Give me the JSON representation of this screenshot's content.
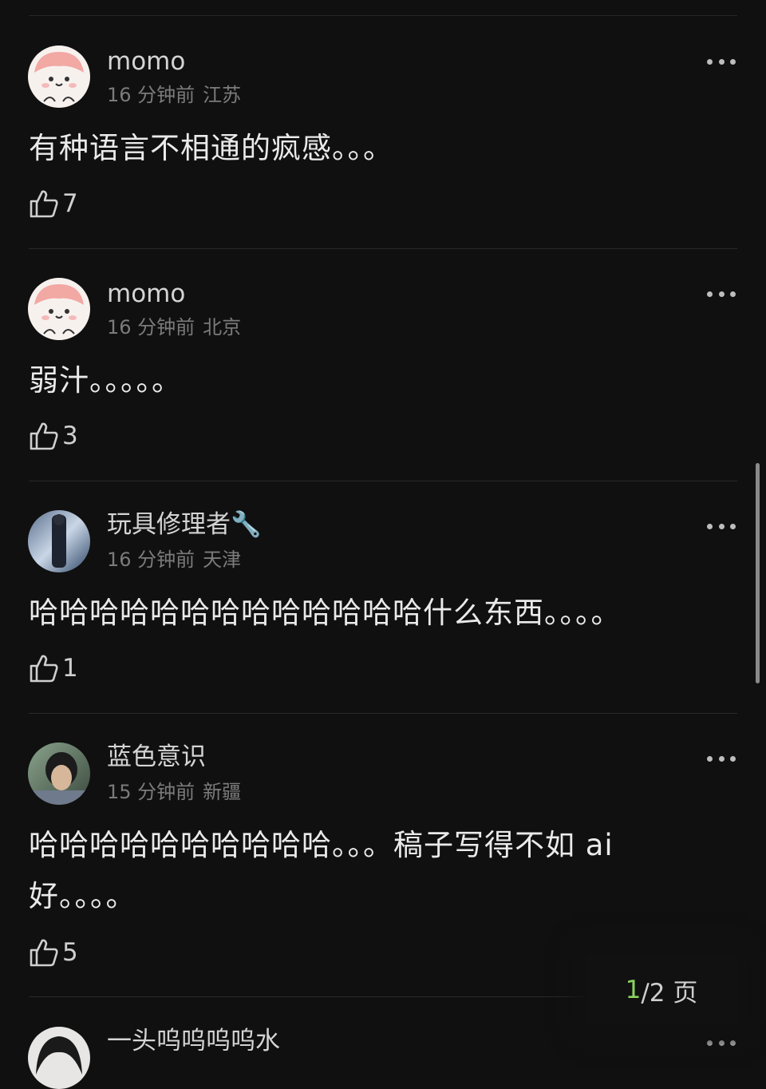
{
  "comments": [
    {
      "username": "momo",
      "time": "16 分钟前",
      "location": "江苏",
      "text": "有种语言不相通的疯感。。。",
      "likes": "7"
    },
    {
      "username": "momo",
      "time": "16 分钟前",
      "location": "北京",
      "text": "弱汁。。。。。",
      "likes": "3"
    },
    {
      "username": "玩具修理者🔧",
      "time": "16 分钟前",
      "location": "天津",
      "text": "哈哈哈哈哈哈哈哈哈哈哈哈哈什么东西。。。。",
      "likes": "1"
    },
    {
      "username": "蓝色意识",
      "time": "15 分钟前",
      "location": "新疆",
      "text": "哈哈哈哈哈哈哈哈哈哈。。。稿子写得不如 ai 好。。。。",
      "likes": "5"
    },
    {
      "username": "一头呜呜呜呜水"
    }
  ],
  "pager": {
    "current": "1",
    "total": "/2 页"
  },
  "colors": {
    "accent": "#8bd25f",
    "background": "#101010"
  }
}
